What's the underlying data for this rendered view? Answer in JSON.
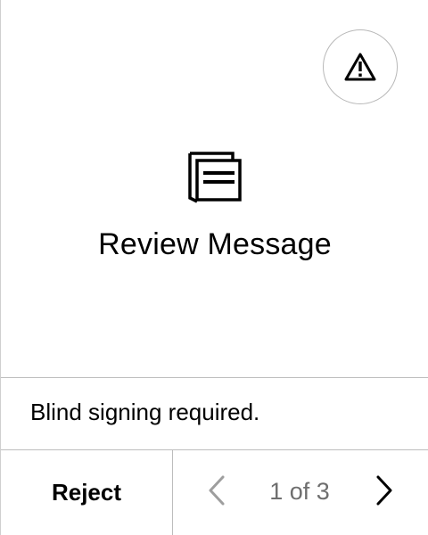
{
  "review": {
    "title": "Review Message",
    "warning_icon": "warning-triangle-icon",
    "message_icon": "message-document-icon"
  },
  "notice": {
    "text": "Blind signing required."
  },
  "footer": {
    "reject_label": "Reject",
    "pager": {
      "label": "1 of 3",
      "current": 1,
      "total": 3,
      "prev_enabled": false,
      "next_enabled": true,
      "prev_icon": "chevron-left-icon",
      "next_icon": "chevron-right-icon"
    }
  },
  "colors": {
    "background": "#ffffff",
    "text": "#000000",
    "muted_text": "#6e6e6e",
    "disabled_icon": "#9e9e9e",
    "divider": "#bdbdbd"
  }
}
